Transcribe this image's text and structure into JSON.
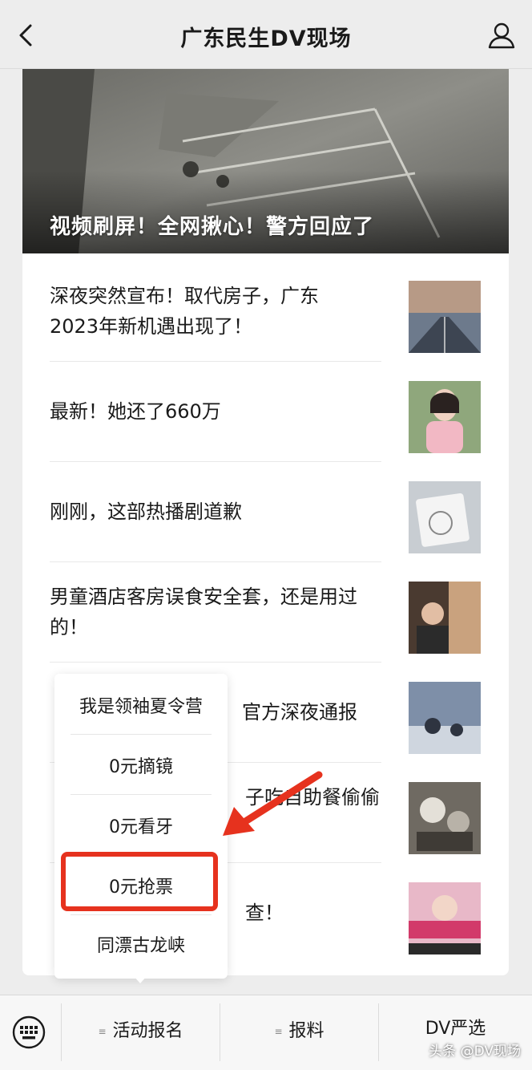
{
  "header": {
    "title": "广东民生DV现场",
    "back_icon": "chevron-left-icon",
    "profile_icon": "person-icon"
  },
  "hero": {
    "title": "视频刷屏！全网揪心！警方回应了"
  },
  "articles": [
    {
      "title": "深夜突然宣布！取代房子，广东2023年新机遇出现了！"
    },
    {
      "title": "最新！她还了660万"
    },
    {
      "title": "刚刚，这部热播剧道歉"
    },
    {
      "title": "男童酒店客房误食安全套，还是用过的！"
    },
    {
      "title": "官方深夜通报"
    },
    {
      "title": "子吃自助餐偷偷"
    },
    {
      "title": "查！"
    }
  ],
  "popup_menu": {
    "items": [
      "我是领袖夏令营",
      "0元摘镜",
      "0元看牙",
      "0元抢票",
      "同漂古龙峡"
    ],
    "highlighted": "0元抢票",
    "highlight_color": "#e6321e"
  },
  "tabbar": {
    "keyboard_icon": "keyboard-icon",
    "menu_glyph": "≡",
    "tabs": [
      {
        "label": "活动报名"
      },
      {
        "label": "报料"
      },
      {
        "label": "DV严选"
      }
    ]
  },
  "watermark": "头条 @DV现场"
}
